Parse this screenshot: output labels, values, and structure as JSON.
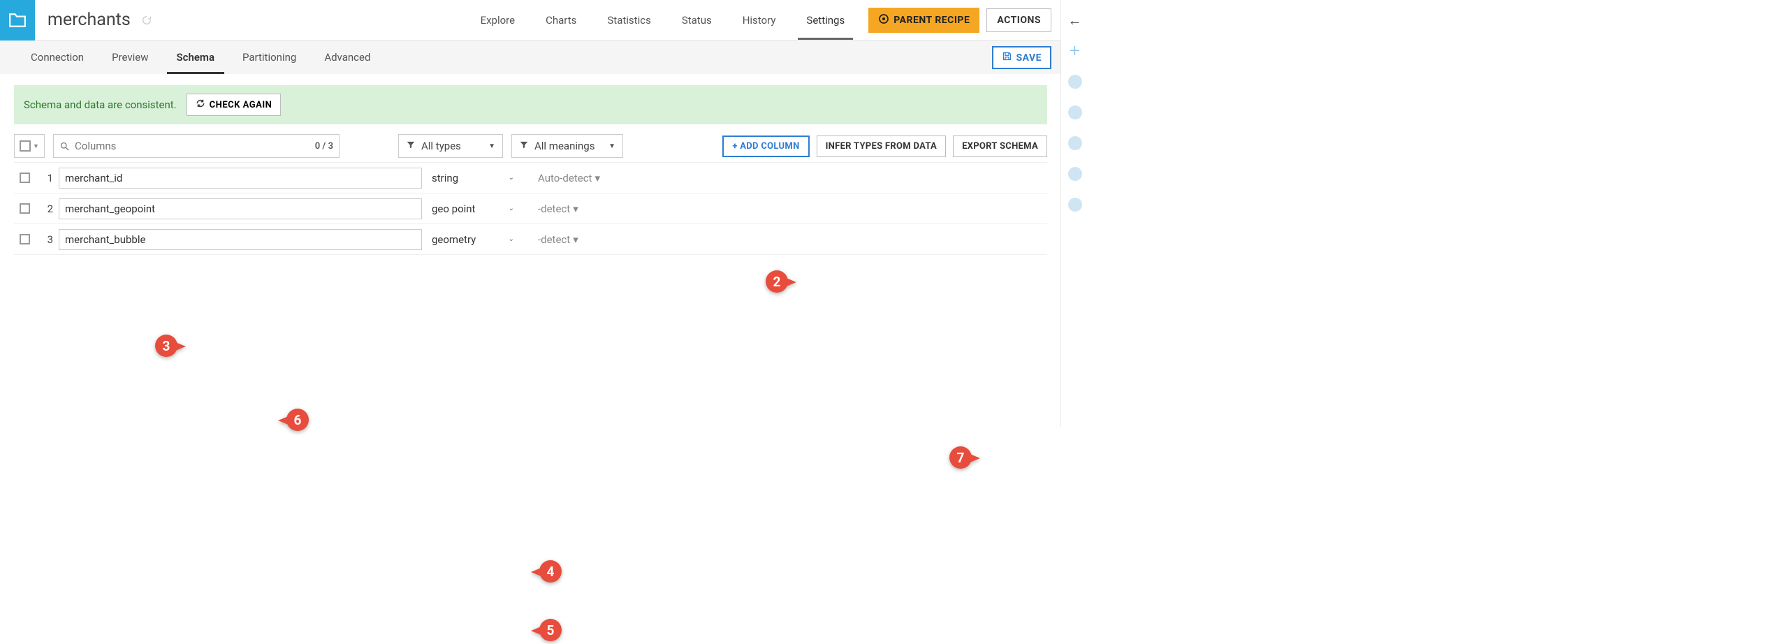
{
  "header": {
    "title": "merchants",
    "nav": [
      "Explore",
      "Charts",
      "Statistics",
      "Status",
      "History",
      "Settings"
    ],
    "active_nav_index": 5,
    "parent_recipe": "PARENT RECIPE",
    "actions": "ACTIONS"
  },
  "subtabs": {
    "items": [
      "Connection",
      "Preview",
      "Schema",
      "Partitioning",
      "Advanced"
    ],
    "active_index": 2,
    "save": "SAVE"
  },
  "banner": {
    "text": "Schema and data are consistent.",
    "button": "CHECK AGAIN"
  },
  "toolbar": {
    "search_placeholder": "Columns",
    "counter": "0 / 3",
    "types_filter": "All types",
    "meanings_filter": "All meanings",
    "add_column": "+ ADD COLUMN",
    "infer": "INFER TYPES FROM DATA",
    "export": "EXPORT SCHEMA"
  },
  "rows": [
    {
      "idx": "1",
      "name": "merchant_id",
      "type": "string",
      "meaning": "Auto-detect"
    },
    {
      "idx": "2",
      "name": "merchant_geopoint",
      "type": "geo point",
      "meaning": "-detect"
    },
    {
      "idx": "3",
      "name": "merchant_bubble",
      "type": "geometry",
      "meaning": "-detect"
    }
  ],
  "callouts": {
    "c2": "2",
    "c3": "3",
    "c4": "4",
    "c5": "5",
    "c6": "6",
    "c7": "7"
  }
}
